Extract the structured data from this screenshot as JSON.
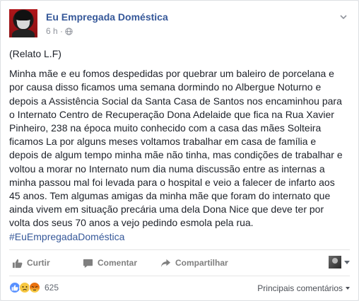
{
  "post": {
    "page_name": "Eu Empregada Doméstica",
    "time": "6 h ·",
    "privacy_icon": "globe-icon",
    "menu_icon": "chevron-down-icon",
    "intro": "(Relato L.F)",
    "body": "Minha mãe e eu fomos despedidas por quebrar um baleiro de porcelana e por causa disso ficamos uma semana dormindo no Albergue Noturno e depois a Assistência Social da Santa Casa de Santos nos encaminhou para o Internato Centro de Recuperação Dona Adelaide que fica na Rua Xavier Pinheiro, 238 na época muito conhecido com a casa das mães Solteira ficamos La por alguns meses voltamos trabalhar em casa de família e depois de algum tempo minha mãe não tinha, mas condições de trabalhar e voltou a morar no Internato num dia numa discussão entre as internas a minha passou mal foi levada para o hospital e veio a falecer de infarto aos 45 anos. Tem algumas amigas da minha mãe que foram do internato que ainda vivem em situação precária uma dela Dona Nice que deve ter por volta dos seus 70 anos a vejo pedindo esmola pela rua.",
    "hashtag": "#EuEmpregadaDoméstica"
  },
  "actions": {
    "like_label": "Curtir",
    "comment_label": "Comentar",
    "share_label": "Compartilhar"
  },
  "reactions": {
    "types": [
      "like",
      "sad",
      "angry"
    ],
    "count": "625",
    "sort_label": "Principais comentários"
  },
  "colors": {
    "link": "#365899",
    "text": "#1d2129",
    "muted": "#90949c",
    "like_blue": "#5890ff"
  }
}
